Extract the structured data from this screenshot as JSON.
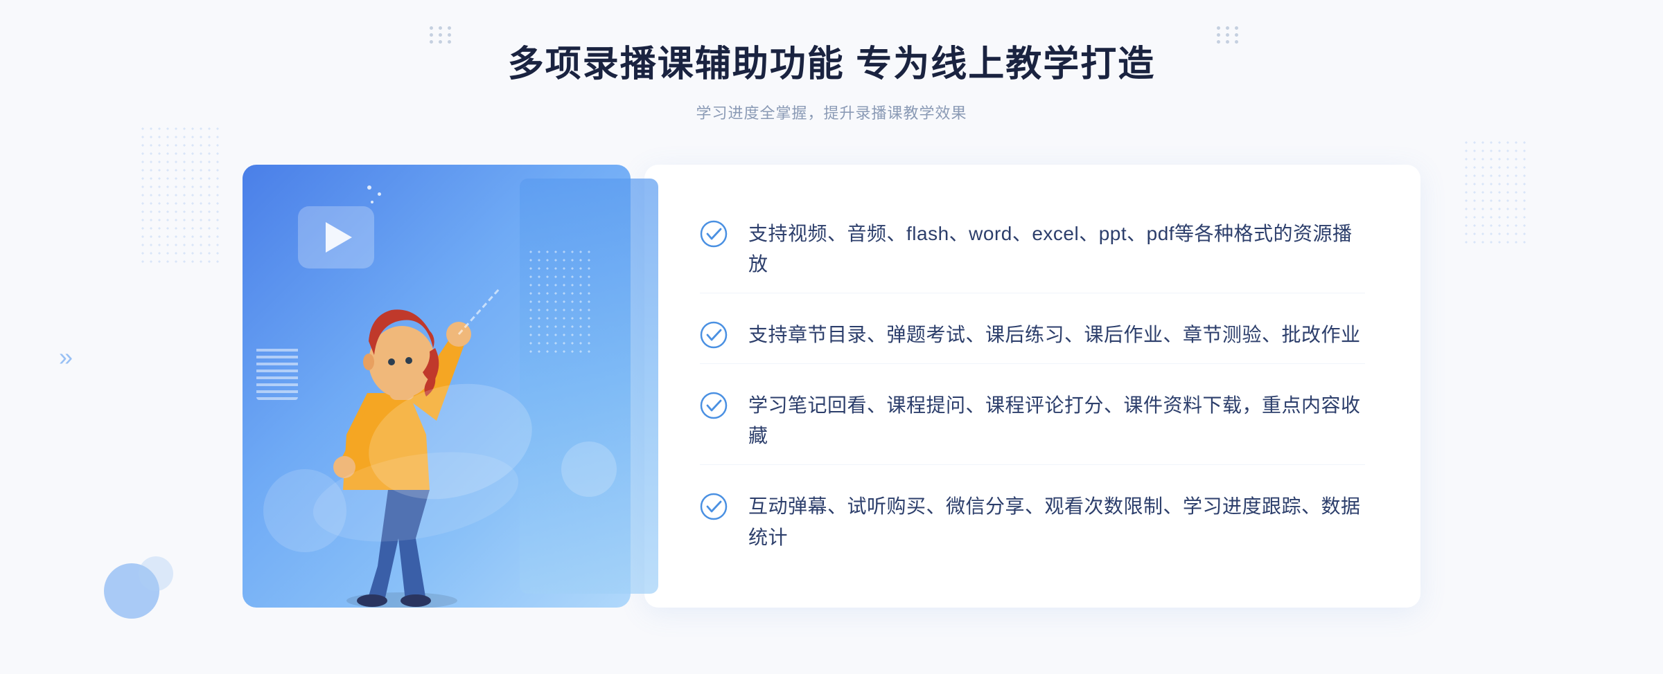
{
  "page": {
    "background_color": "#f8f9fc"
  },
  "header": {
    "main_title": "多项录播课辅助功能 专为线上教学打造",
    "sub_title": "学习进度全掌握，提升录播课教学效果"
  },
  "features": [
    {
      "id": "feature-1",
      "text": "支持视频、音频、flash、word、excel、ppt、pdf等各种格式的资源播放"
    },
    {
      "id": "feature-2",
      "text": "支持章节目录、弹题考试、课后练习、课后作业、章节测验、批改作业"
    },
    {
      "id": "feature-3",
      "text": "学习笔记回看、课程提问、课程评论打分、课件资料下载，重点内容收藏"
    },
    {
      "id": "feature-4",
      "text": "互动弹幕、试听购买、微信分享、观看次数限制、学习进度跟踪、数据统计"
    }
  ],
  "icons": {
    "check": "check-circle-icon",
    "play": "play-icon",
    "left_arrow": "left-navigation-arrow"
  },
  "colors": {
    "primary_blue": "#4a7fe8",
    "light_blue": "#6faaf5",
    "text_dark": "#2c3e6b",
    "text_gray": "#8a9ab5",
    "check_color": "#4a90e2"
  }
}
